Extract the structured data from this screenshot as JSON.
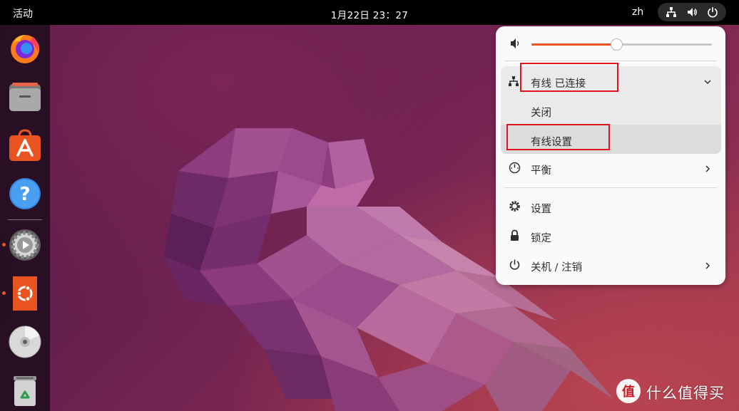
{
  "topbar": {
    "activities": "活动",
    "clock": "1月22日  23：27",
    "language": "zh",
    "tray_icons": [
      "network-wired-icon",
      "volume-icon",
      "power-icon"
    ]
  },
  "dock": {
    "apps": [
      {
        "name": "Firefox",
        "icon": "firefox-icon",
        "running": false
      },
      {
        "name": "Files",
        "icon": "files-icon",
        "running": false
      },
      {
        "name": "Ubuntu Software",
        "icon": "app-store-icon",
        "running": false
      },
      {
        "name": "Help",
        "icon": "help-icon",
        "running": false
      },
      {
        "name": "Settings",
        "icon": "settings-icon",
        "running": true
      },
      {
        "name": "Ubuntu Installer",
        "icon": "ubuntu-icon",
        "running": true
      },
      {
        "name": "Disc",
        "icon": "disc-icon",
        "running": false
      },
      {
        "name": "Trash",
        "icon": "trash-icon",
        "running": false
      }
    ]
  },
  "menu": {
    "volume_level": 0.47,
    "network": {
      "status": "有线 已连接",
      "items": [
        "关闭",
        "有线设置"
      ]
    },
    "power_mode": "平衡",
    "settings": "设置",
    "lock": "锁定",
    "power_off": "关机 / 注销"
  },
  "watermark": {
    "text": "什么值得买",
    "logo": "值"
  },
  "colors": {
    "accent": "#e95420",
    "highlight_box": "#e0141e",
    "topbar": "#000000"
  }
}
